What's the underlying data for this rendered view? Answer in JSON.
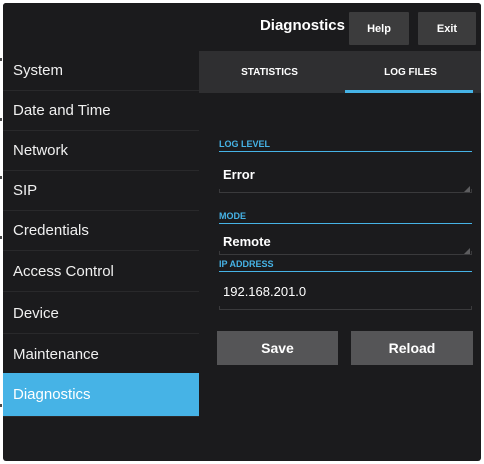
{
  "header": {
    "title": "Diagnostics",
    "help_label": "Help",
    "exit_label": "Exit"
  },
  "sidebar": {
    "items": [
      {
        "label": "System"
      },
      {
        "label": "Date and Time"
      },
      {
        "label": "Network"
      },
      {
        "label": "SIP"
      },
      {
        "label": "Credentials"
      },
      {
        "label": "Access Control"
      },
      {
        "label": "Device"
      },
      {
        "label": "Maintenance"
      },
      {
        "label": "Diagnostics"
      }
    ],
    "active": "Diagnostics"
  },
  "tabs": [
    {
      "label": "STATISTICS"
    },
    {
      "label": "LOG FILES"
    }
  ],
  "active_tab": "LOG FILES",
  "form": {
    "log_level": {
      "label": "LOG LEVEL",
      "value": "Error"
    },
    "mode": {
      "label": "MODE",
      "value": "Remote"
    },
    "ip_address": {
      "label": "IP ADDRESS",
      "value": "192.168.201.0"
    }
  },
  "buttons": {
    "save": "Save",
    "reload": "Reload"
  },
  "colors": {
    "accent": "#46b3e6",
    "background": "#1b1b1d",
    "button": "#555557"
  }
}
